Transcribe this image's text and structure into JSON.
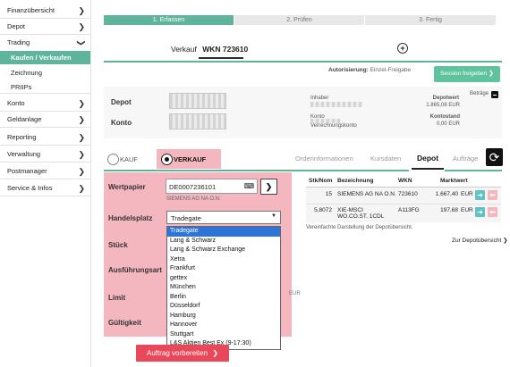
{
  "sidebar": {
    "items": [
      {
        "label": "Finanzübersicht"
      },
      {
        "label": "Depot"
      },
      {
        "label": "Trading"
      },
      {
        "label": "Konto"
      },
      {
        "label": "Geldanlage"
      },
      {
        "label": "Reporting"
      },
      {
        "label": "Verwaltung"
      },
      {
        "label": "Postmanager"
      },
      {
        "label": "Service & Infos"
      }
    ],
    "trading_sub": [
      {
        "label": "Kaufen / Verkaufen"
      },
      {
        "label": "Zeichnung"
      },
      {
        "label": "PRIIPs"
      }
    ]
  },
  "steps": [
    "1. Erfassen",
    "2. Prüfen",
    "3. Fertig"
  ],
  "order_tab": {
    "label": "Verkauf",
    "wkn": "WKN 723610"
  },
  "authorization": {
    "label": "Autorisierung:",
    "value": "Einzel-Freigabe",
    "button": "Session freigeben"
  },
  "depot": {
    "depot_label": "Depot",
    "konto_label": "Konto",
    "inhaber": "Inhaber",
    "konto": "Konto",
    "verrechnungskonto": "Verrechnungskonto",
    "depotwert_label": "Depotwert",
    "depotwert": "1.865,08",
    "depotwert_cur": "EUR",
    "kontostand_label": "Kontostand",
    "kontostand": "0,00",
    "kontostand_cur": "EUR",
    "betraege": "Beträge"
  },
  "trade_type": {
    "kauf": "KAUF",
    "verkauf": "VERKAUF"
  },
  "right_tabs": [
    "Orderinformationen",
    "Kursdaten",
    "Depot",
    "Aufträge"
  ],
  "form": {
    "wertpapier_label": "Wertpapier",
    "isin": "DE0007236101",
    "name": "SIEMENS AG NA O.N.",
    "handelsplatz_label": "Handelsplatz",
    "handelsplatz_value": "Tradegate",
    "stueck_label": "Stück",
    "ausfuehrungsart_label": "Ausführungsart",
    "limit_label": "Limit",
    "limit_cur": "EUR",
    "gueltigkeit_label": "Gültigkeit",
    "submit": "Auftrag vorbereiten"
  },
  "dropdown_options": [
    "Tradegate",
    "Lang & Schwarz",
    "Lang & Schwarz Exchange",
    "Xetra",
    "Frankfurt",
    "gettex",
    "München",
    "Berlin",
    "Düsseldorf",
    "Hamburg",
    "Hannover",
    "Stuttgart",
    "L&S Aktien Best Ex (9-17:30)"
  ],
  "depot_table": {
    "headers": [
      "Stk/Nom",
      "Bezeichnung",
      "WKN",
      "Marktwert"
    ],
    "rows": [
      {
        "stk": "15",
        "name": "SIEMENS AG NA O.N.",
        "wkn": "723610",
        "wert": "1.667,40",
        "cur": "EUR"
      },
      {
        "stk": "5,8072",
        "name": "XIE-MSCI WO.CO.ST. 1CDL",
        "wkn": "A113FG",
        "wert": "197,68",
        "cur": "EUR"
      }
    ],
    "note": "Vereinfachte Darstellung der Depotübersicht.",
    "link": "Zur Depotübersicht"
  },
  "colors": {
    "green": "#5fb49c",
    "pink": "#f4b7bf",
    "red": "#e8485a",
    "blue": "#2e73d6"
  }
}
